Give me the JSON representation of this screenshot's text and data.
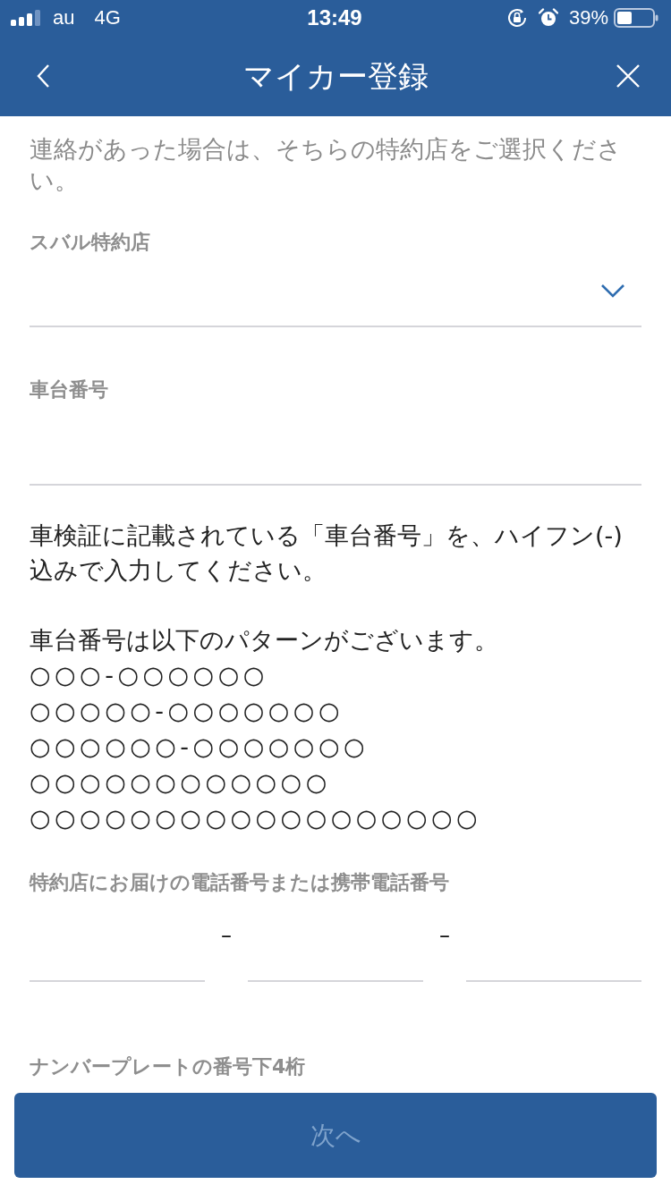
{
  "status_bar": {
    "carrier": "au",
    "network": "4G",
    "time": "13:49",
    "battery": "39%"
  },
  "nav_bar": {
    "title": "マイカー登録"
  },
  "form": {
    "notice": "連絡があった場合は、そちらの特約店をご選択ください。",
    "fields": [
      {
        "kind": "select",
        "label": "スバル特約店"
      },
      {
        "kind": "text",
        "label": "車台番号",
        "help": {
          "instruction": "車検証に記載されている「車台番号」を、ハイフン(-)込みで入力してください。",
          "intro": "車台番号は以下のパターンがございます。",
          "patterns": [
            "○○○-○○○○○○",
            "○○○○○-○○○○○○○",
            "○○○○○○-○○○○○○○",
            "○○○○○○○○○○○○",
            "○○○○○○○○○○○○○○○○○○"
          ]
        }
      },
      {
        "kind": "phone",
        "label": "特約店にお届けの電話番号または携帯電話番号",
        "separators": [
          "–",
          "–"
        ]
      },
      {
        "kind": "clipped",
        "label": "ナンバープレートの番号下4桁"
      }
    ]
  },
  "next_button": {
    "label": "次へ",
    "disabled": true
  }
}
